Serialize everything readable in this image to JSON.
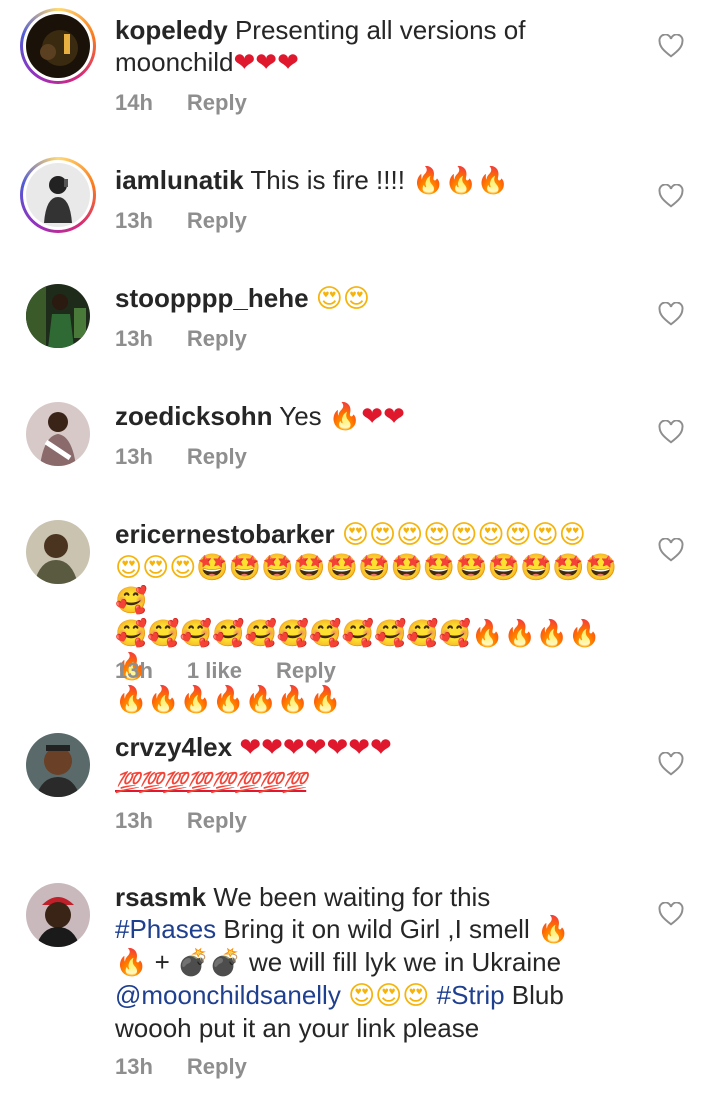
{
  "comments": [
    {
      "username": "kopeledy",
      "text": "Presenting all versions of moonchild",
      "emoji": "❤❤❤",
      "time": "14h",
      "reply": "Reply"
    },
    {
      "username": "iamlunatik",
      "text": "This is fire !!!!",
      "emoji": "🔥🔥🔥",
      "time": "13h",
      "reply": "Reply"
    },
    {
      "username": "stoopppp_hehe",
      "text": "",
      "emoji": "😍😍",
      "time": "13h",
      "reply": "Reply"
    },
    {
      "username": "zoedicksohn",
      "text": "Yes",
      "emoji": "🔥❤❤",
      "time": "13h",
      "reply": "Reply"
    },
    {
      "username": "ericernestobarker",
      "emoji_line1": "😍😍😍😍😍😍😍😍😍",
      "emoji_line2": "😍😍😍🤩🤩🤩🤩🤩🤩🤩🤩🤩🤩🤩🤩🤩🥰",
      "emoji_line3": "🥰🥰🥰🥰🥰🥰🥰🥰🥰🥰🥰🔥🔥🔥🔥🔥",
      "emoji_line4": "🔥🔥🔥🔥🔥🔥🔥",
      "time": "13h",
      "likes": "1 like",
      "reply": "Reply"
    },
    {
      "username": "crvzy4lex",
      "emoji": "❤❤❤❤❤❤❤",
      "emoji_line2": "💯💯💯💯💯💯💯💯",
      "time": "13h",
      "reply": "Reply"
    },
    {
      "username": "rsasmk",
      "text_1": "We been waiting for this",
      "hashtag_1": "#Phases",
      "text_2": "Bring it on wild Girl ,I smell",
      "fire_1": "🔥",
      "fire_2": "🔥",
      "text_3": "+",
      "bombs": "💣💣",
      "text_4": "we will fill lyk we in Ukraine",
      "mention": "@moonchildsanelly",
      "emoji_love": "😍😍😍",
      "hashtag_2": "#Strip",
      "text_5": "Blub",
      "text_6": "woooh put it an your link please",
      "time": "13h",
      "reply": "Reply"
    }
  ],
  "icons": {
    "like": "heart-outline-icon"
  },
  "colors": {
    "text": "#262626",
    "meta": "#8e8e8e",
    "link": "#1f3f8f",
    "heart": "#e0182d"
  }
}
